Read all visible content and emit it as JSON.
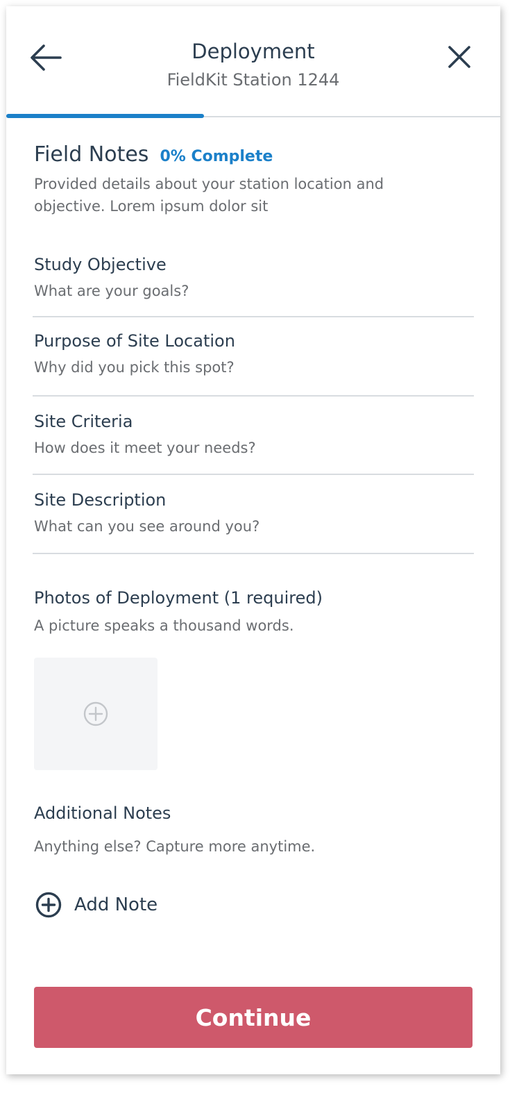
{
  "header": {
    "title": "Deployment",
    "subtitle": "FieldKit Station 1244",
    "back_icon": "arrow-left-icon",
    "close_icon": "close-icon",
    "progress": 0.4
  },
  "section": {
    "title": "Field Notes",
    "complete": "0% Complete",
    "description": "Provided details about your station location and objective. Lorem ipsum dolor sit"
  },
  "fields": [
    {
      "label": "Study Objective",
      "hint": "What are your goals?"
    },
    {
      "label": "Purpose of Site Location",
      "hint": "Why did you pick this spot?"
    },
    {
      "label": "Site Criteria",
      "hint": "How does it meet your needs?"
    },
    {
      "label": "Site Description",
      "hint": "What can you see around you?"
    }
  ],
  "photos": {
    "label": "Photos of Deployment (1 required)",
    "hint": "A picture speaks a thousand words.",
    "add_icon": "plus-circle-icon"
  },
  "notes": {
    "label": "Additional Notes",
    "hint": "Anything else? Capture more anytime.",
    "add_label": "Add Note",
    "add_icon": "plus-circle-icon"
  },
  "footer": {
    "continue_label": "Continue"
  },
  "colors": {
    "accent": "#1b80c9",
    "primary_button": "#ce596b",
    "text": "#2c3e50",
    "muted_text": "#6a6d71",
    "divider": "#d8dce0"
  }
}
